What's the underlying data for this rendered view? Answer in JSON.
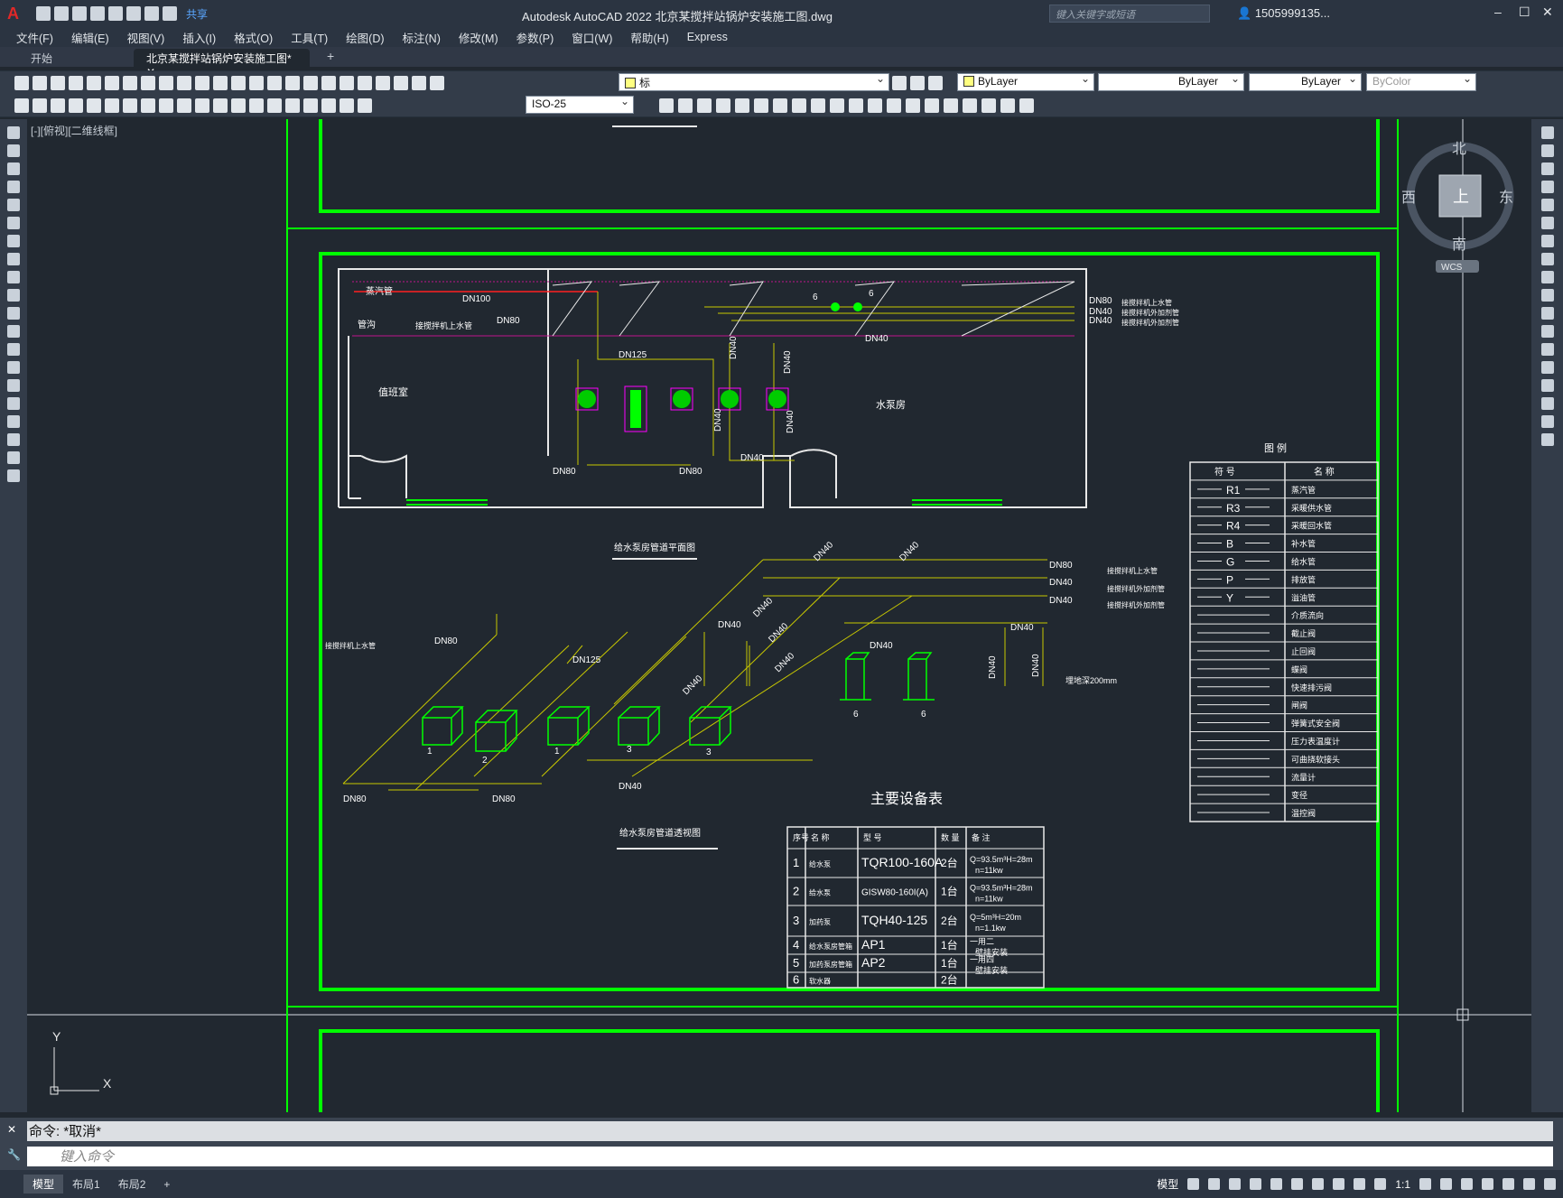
{
  "app": {
    "logo": "A",
    "share": "共享",
    "title": "Autodesk AutoCAD 2022    北京某搅拌站锅炉安装施工图.dwg",
    "search_placeholder": "键入关键字或短语",
    "user": "1505999135...",
    "window_controls": [
      "–",
      "☐",
      "✕"
    ]
  },
  "menu": [
    "文件(F)",
    "编辑(E)",
    "视图(V)",
    "插入(I)",
    "格式(O)",
    "工具(T)",
    "绘图(D)",
    "标注(N)",
    "修改(M)",
    "参数(P)",
    "窗口(W)",
    "帮助(H)",
    "Express"
  ],
  "tabs": {
    "start": "开始",
    "doc": "北京某搅拌站锅炉安装施工图*",
    "plus": "+"
  },
  "toolbar": {
    "layer_value": "标",
    "color": "ByLayer",
    "linetype": "ByLayer",
    "lineweight": "ByLayer",
    "plotstyle": "ByColor",
    "dimstyle": "ISO-25"
  },
  "viewport": {
    "label": "[-][俯视][二维线框]",
    "viewcube": {
      "north": "北",
      "south": "南",
      "east": "东",
      "west": "西",
      "top": "上",
      "wcs": "WCS"
    },
    "ucs_x": "X",
    "ucs_y": "Y"
  },
  "drawing": {
    "plan_title": "给水泵房管道平面图",
    "axo_title": "给水泵房管道透视图",
    "rooms": {
      "left": "值班室",
      "right": "水泵房"
    },
    "plan_labels": {
      "steam": "蒸汽管",
      "pipe": "管沟",
      "to_mixer": "接搅拌机上水管",
      "dn100": "DN100",
      "dn80a": "DN80",
      "dn125": "DN125",
      "dn40a": "DN40",
      "dn40b": "DN40",
      "dn40c": "DN40",
      "dn40d": "DN40",
      "dn80b": "DN80",
      "dn80c": "DN80",
      "dn40e": "DN40",
      "r1": "DN80",
      "r2": "DN40",
      "r3": "DN40",
      "out1": "接搅拌机上水管",
      "out2": "接搅拌机外加剂管",
      "out3": "接搅拌机外加剂管",
      "n6a": "6",
      "n6b": "6"
    },
    "axo_labels": {
      "dn80a": "DN80",
      "dn80b": "DN80",
      "dn80c": "DN80",
      "dn125": "DN125",
      "dn40a": "DN40",
      "dn40b": "DN40",
      "dn40c": "DN40",
      "dn40d": "DN40",
      "dn40e": "DN40",
      "dn40f": "DN40",
      "dn40g": "DN40",
      "dn40h": "DN40",
      "dn40i": "DN40",
      "dn40j": "DN40",
      "dn40k": "DN40",
      "dn40l": "DN40",
      "r1": "DN80",
      "r2": "DN40",
      "r3": "DN40",
      "out1": "接搅拌机上水管",
      "out2": "接搅拌机外加剂管",
      "out3": "接搅拌机外加剂管",
      "to_mixer": "接搅拌机上水管",
      "depth": "埋地深200mm",
      "n1a": "1",
      "n2": "2",
      "n1b": "1",
      "n3a": "3",
      "n3b": "3",
      "n6a": "6",
      "n6b": "6"
    },
    "legend_title": "图  例",
    "legend_headers": [
      "符 号",
      "名 称"
    ],
    "legend": [
      [
        "R1",
        "蒸汽管"
      ],
      [
        "R3",
        "采暖供水管"
      ],
      [
        "R4",
        "采暖回水管"
      ],
      [
        "B",
        "补水管"
      ],
      [
        "G",
        "给水管"
      ],
      [
        "P",
        "排放管"
      ],
      [
        "Y",
        "溢油管"
      ],
      [
        "",
        "介质流向"
      ],
      [
        "",
        "截止阀"
      ],
      [
        "",
        "止回阀"
      ],
      [
        "",
        "蝶阀"
      ],
      [
        "",
        "快速排污阀"
      ],
      [
        "",
        "闸阀"
      ],
      [
        "",
        "弹簧式安全阀"
      ],
      [
        "",
        "压力表温度计"
      ],
      [
        "",
        "可曲挠软接头"
      ],
      [
        "",
        "流量计"
      ],
      [
        "",
        "变径"
      ],
      [
        "",
        "温控阀"
      ]
    ],
    "equip_title": "主要设备表",
    "equip_headers": [
      "序号",
      "名 称",
      "型 号",
      "数 量",
      "备 注"
    ],
    "equip": [
      [
        "1",
        "给水泵",
        "TQR100-160A",
        "2台",
        "Q=93.5m³H=28m n=11kw"
      ],
      [
        "2",
        "给水泵",
        "GISW80-160I(A)",
        "1台",
        "Q=93.5m³H=28m n=11kw"
      ],
      [
        "3",
        "加药泵",
        "TQH40-125",
        "2台",
        "Q=5m³H=20m n=1.1kw"
      ],
      [
        "4",
        "给水泵房管箱",
        "AP1",
        "1台",
        "一用二 壁挂安装"
      ],
      [
        "5",
        "加药泵房管箱",
        "AP2",
        "1台",
        "一用四 壁挂安装"
      ],
      [
        "6",
        "软水器",
        "",
        "2台",
        ""
      ]
    ]
  },
  "command": {
    "history": "命令:  *取消*",
    "placeholder": "键入命令"
  },
  "status": {
    "tabs": [
      "模型",
      "布局1",
      "布局2"
    ],
    "plus": "+",
    "model": "模型",
    "scale": "1:1"
  },
  "colors": {
    "green": "#00ff00",
    "yellow": "#c8c800",
    "magenta": "#ff00ff",
    "red": "#ff2020",
    "white": "#e8e8e8"
  }
}
